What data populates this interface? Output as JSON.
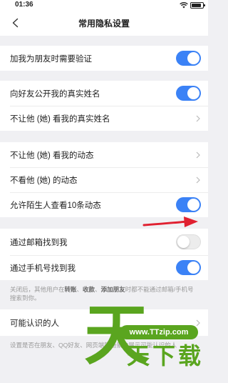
{
  "status_bar": {
    "time": "01:36"
  },
  "nav": {
    "title": "常用隐私设置"
  },
  "groups": [
    {
      "rows": [
        {
          "label": "加我为朋友时需要验证",
          "control": "toggle",
          "on": true
        }
      ]
    },
    {
      "rows": [
        {
          "label": "向好友公开我的真实姓名",
          "control": "toggle",
          "on": true
        },
        {
          "label": "不让他 (她) 看我的真实姓名",
          "control": "chevron"
        }
      ]
    },
    {
      "rows": [
        {
          "label": "不让他 (她) 看我的动态",
          "control": "chevron"
        },
        {
          "label": "不看他 (她) 的动态",
          "control": "chevron"
        },
        {
          "label": "允许陌生人查看10条动态",
          "control": "toggle",
          "on": true
        }
      ]
    },
    {
      "rows": [
        {
          "label": "通过邮箱找到我",
          "control": "toggle",
          "on": false
        },
        {
          "label": "通过手机号找到我",
          "control": "toggle",
          "on": true
        }
      ]
    },
    {
      "rows": [
        {
          "label": "可能认识的人",
          "control": "chevron"
        }
      ]
    }
  ],
  "find_note": {
    "prefix": "关闭后，其他用户在",
    "k1": "转账",
    "sep1": "、",
    "k2": "收款",
    "sep2": "、",
    "k3": "添加朋友",
    "suffix": "时都不能通过邮箱/手机号搜索到你。"
  },
  "people_note": "设置是否在朋友、QQ好友、网页端等场景中展示可能认识的人",
  "watermark": {
    "url": "www.TTzip.com",
    "big": "天",
    "small": "天下载"
  },
  "colors": {
    "accent": "#3b82f6",
    "arrow": "#e02030",
    "watermark": "#5aa51f"
  }
}
